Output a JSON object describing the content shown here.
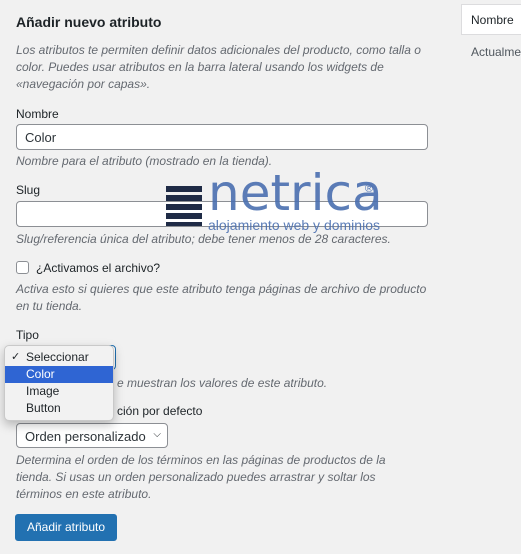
{
  "side": {
    "column_label": "Nombre",
    "cut_text": "Actualme"
  },
  "form": {
    "title": "Añadir nuevo atributo",
    "intro": "Los atributos te permiten definir datos adicionales del producto, como talla o color. Puedes usar atributos en la barra lateral usando los widgets de «navegación por capas».",
    "name": {
      "label": "Nombre",
      "value": "Color",
      "help": "Nombre para el atributo (mostrado en la tienda)."
    },
    "slug": {
      "label": "Slug",
      "value": "",
      "help": "Slug/referencia única del atributo; debe tener menos de 28 caracteres."
    },
    "archive": {
      "label": "¿Activamos el archivo?",
      "checked": false,
      "help": "Activa esto si quieres que este atributo tenga páginas de archivo de producto en tu tienda."
    },
    "type": {
      "label": "Tipo",
      "help_visible": "e muestran los valores de este atributo.",
      "options": [
        {
          "label": "Seleccionar",
          "checked": true,
          "highlighted": false
        },
        {
          "label": "Color",
          "checked": false,
          "highlighted": true
        },
        {
          "label": "Image",
          "checked": false,
          "highlighted": false
        },
        {
          "label": "Button",
          "checked": false,
          "highlighted": false
        }
      ]
    },
    "order": {
      "label_visible": "ción por defecto",
      "value": "Orden personalizado",
      "help": "Determina el orden de los términos en las páginas de productos de la tienda. Si usas un orden personalizado puedes arrastrar y soltar los términos en este atributo."
    },
    "submit_label": "Añadir atributo"
  },
  "watermark": {
    "word": "netrica",
    "tagline": "alojamiento web y dominios",
    "reg": "®"
  },
  "colors": {
    "accent": "#2271b1",
    "highlight": "#2f65d3",
    "background": "#f1f1f1",
    "help_text": "#646970"
  }
}
